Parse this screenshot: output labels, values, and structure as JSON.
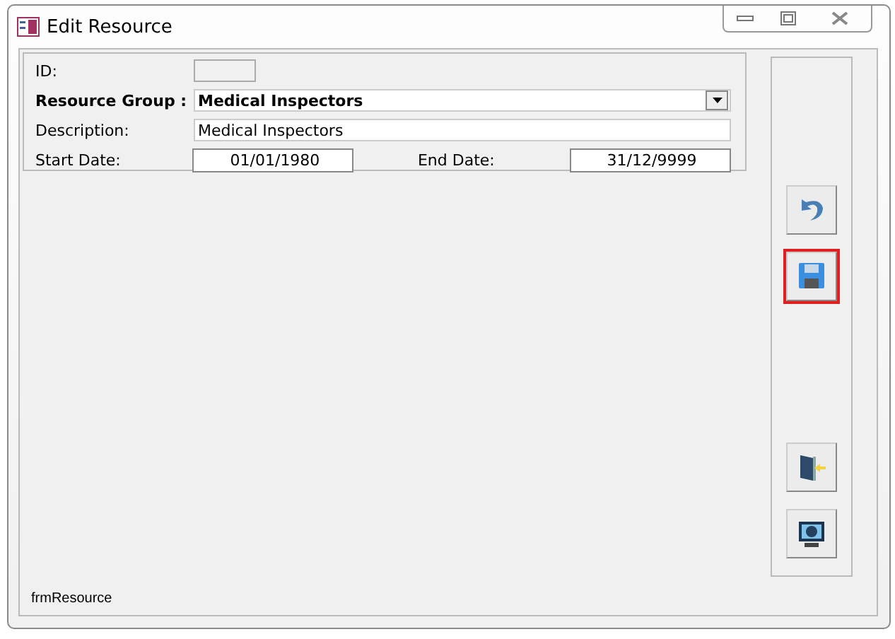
{
  "window": {
    "title": "Edit Resource"
  },
  "fields": [
    {
      "kind": "blank",
      "label": "ID:"
    },
    {
      "kind": "combo",
      "label": "Resource Group :",
      "value": "Medical Inspectors"
    },
    {
      "kind": "text",
      "label": "Description:",
      "value": "Medical Inspectors"
    }
  ],
  "dates": [
    {
      "label": "Start Date:",
      "value": "01/01/1980"
    },
    {
      "label": "End Date:",
      "value": "31/12/9999"
    }
  ],
  "buttons": [
    {
      "kind": "undo",
      "highlighted": false
    },
    {
      "kind": "save",
      "highlighted": true
    },
    {
      "kind": "exit",
      "highlighted": false
    },
    {
      "kind": "monitor",
      "highlighted": false
    }
  ],
  "status_bar": {
    "text": "frmResource"
  }
}
